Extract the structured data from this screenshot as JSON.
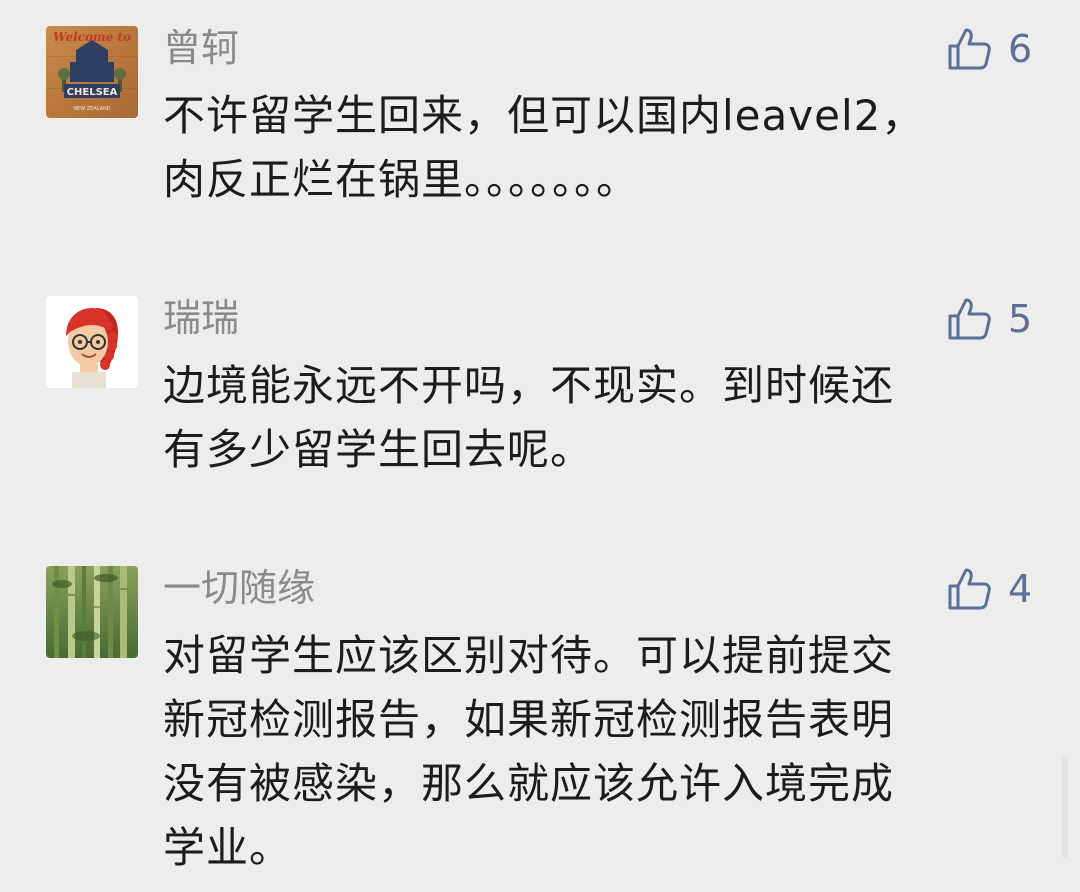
{
  "comments": [
    {
      "name": "曾轲",
      "avatar_text_top": "Welcome to",
      "avatar_text_main": "CHELSEA",
      "avatar_text_bottom": "NEW ZEALAND",
      "like_count": "6",
      "text_lines": [
        "不许留学生回来，但可以国内leavel2，",
        "肉反正烂在锅里。。。。。。。"
      ]
    },
    {
      "name": "瑞瑞",
      "avatar_icon": "redhead-girl-with-glasses-avatar",
      "like_count": "5",
      "text_lines": [
        "边境能永远不开吗，不现实。到时候还",
        "有多少留学生回去呢。"
      ]
    },
    {
      "name": "一切随缘",
      "avatar_icon": "bamboo-forest-avatar",
      "like_count": "4",
      "text_lines": [
        "对留学生应该区别对待。可以提前提交",
        "新冠检测报告，如果新冠检测报告表明",
        "没有被感染，那么就应该允许入境完成",
        "学业。"
      ]
    }
  ],
  "icons": {
    "like": "thumbs-up-icon"
  },
  "colors": {
    "background": "#ededed",
    "name": "#8a8a8a",
    "text": "#1c1c1c",
    "like": "#5c6f96"
  }
}
